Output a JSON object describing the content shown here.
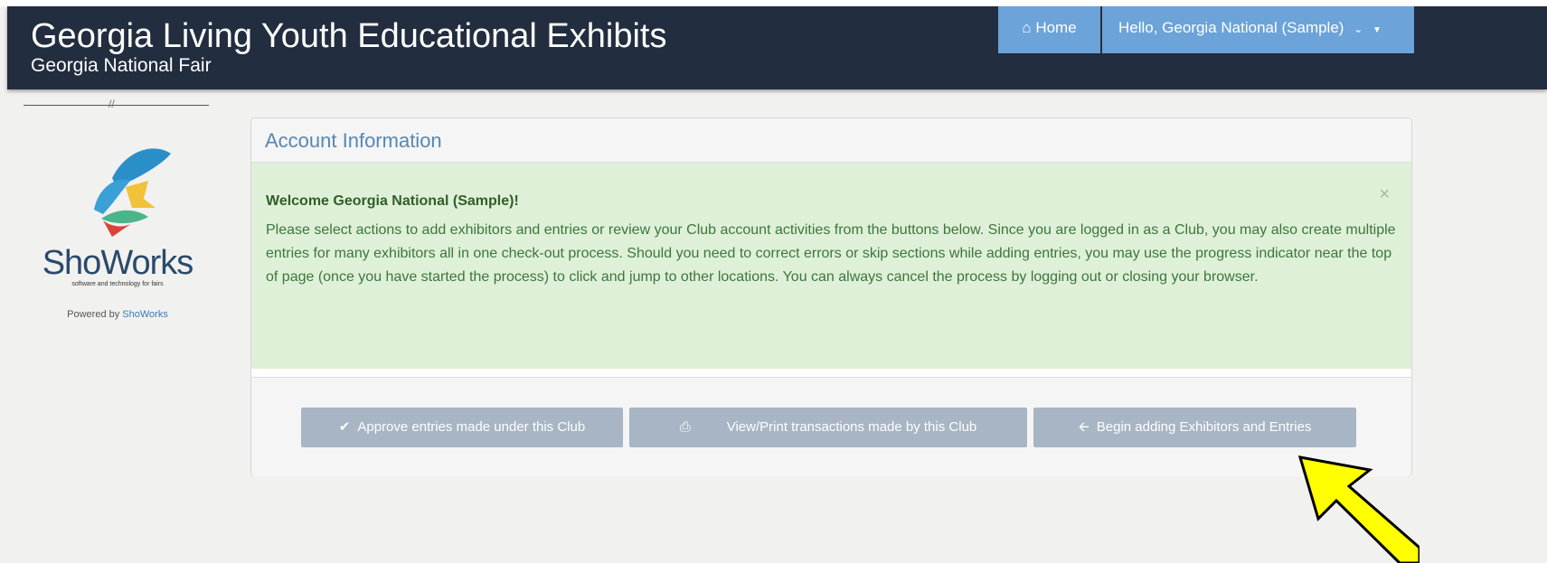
{
  "header": {
    "title": "Georgia Living Youth Educational Exhibits",
    "subtitle": "Georgia National Fair",
    "home_label": "Home",
    "user_label": "Hello, Georgia National (Sample)"
  },
  "sidebar": {
    "logo_text": "ShoWorks",
    "logo_tagline": "software and technology for fairs",
    "powered_prefix": "Powered by",
    "powered_link": "ShoWorks"
  },
  "panel": {
    "title": "Account Information",
    "alert": {
      "heading": "Welcome Georgia National (Sample)!",
      "body": "Please select actions to add exhibitors and entries or review your Club account activities from the buttons below. Since you are logged in as a Club, you may also create multiple entries for many exhibitors all in one check-out process. Should you need to correct errors or skip sections while adding entries, you may use the progress indicator near the top of page (once you have started the process) to click and jump to other locations. You can always cancel the process by logging out or closing your browser.",
      "close_glyph": "×"
    },
    "buttons": [
      {
        "label": "Approve entries made under this Club",
        "icon": "check-icon"
      },
      {
        "label": "View/Print transactions made by this Club",
        "icon": "print-icon"
      },
      {
        "label": "Begin adding Exhibitors and Entries",
        "icon": "arrow-left-icon"
      }
    ]
  },
  "colors": {
    "navbar": "#222d3f",
    "nav_button": "#6ca3d8",
    "alert_bg": "#dff0d8",
    "button_bg": "#a7b5c4",
    "annotation_arrow": "#ffff00"
  }
}
